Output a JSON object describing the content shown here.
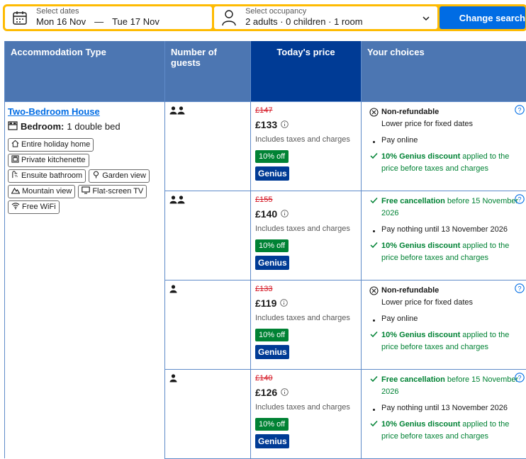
{
  "search": {
    "dates_label": "Select dates",
    "checkin": "Mon 16 Nov",
    "dash": "—",
    "checkout": "Tue 17 Nov",
    "occupancy_label": "Select occupancy",
    "occupancy_value": "2 adults · 0 children · 1 room",
    "button": "Change search"
  },
  "table": {
    "headers": [
      "Accommodation Type",
      "Number of guests",
      "Today's price",
      "Your choices"
    ]
  },
  "room": {
    "name": "Two-Bedroom House",
    "bedroom_label": "Bedroom:",
    "bedroom_value": "1 double bed",
    "amenities": [
      {
        "label": "Entire holiday home",
        "icon": "home-icon"
      },
      {
        "label": "Private kitchenette",
        "icon": "kitchen-icon"
      },
      {
        "label": "Ensuite bathroom",
        "icon": "shower-icon"
      },
      {
        "label": "Garden view",
        "icon": "tree-icon"
      },
      {
        "label": "Mountain view",
        "icon": "mountain-icon"
      },
      {
        "label": "Flat-screen TV",
        "icon": "tv-icon"
      },
      {
        "label": "Free WiFi",
        "icon": "wifi-icon"
      }
    ]
  },
  "rows": [
    {
      "guests": 2,
      "old_price": "£147",
      "price": "£133",
      "taxes": "Includes taxes and charges",
      "discount": "10% off",
      "genius": "Genius",
      "choices": {
        "first_title": "Non-refundable",
        "first_sub": "Lower price for fixed dates",
        "first_type": "nonrefund",
        "second": "Pay online",
        "genius_bold": "10% Genius discount",
        "genius_rest": " applied to the price before taxes and charges"
      }
    },
    {
      "guests": 2,
      "old_price": "£155",
      "price": "£140",
      "taxes": "Includes taxes and charges",
      "discount": "10% off",
      "genius": "Genius",
      "choices": {
        "first_title": "Free cancellation",
        "first_sub": " before 15 November 2026",
        "first_type": "free",
        "second": "Pay nothing until 13 November 2026",
        "genius_bold": "10% Genius discount",
        "genius_rest": " applied to the price before taxes and charges"
      }
    },
    {
      "guests": 1,
      "old_price": "£133",
      "price": "£119",
      "taxes": "Includes taxes and charges",
      "discount": "10% off",
      "genius": "Genius",
      "choices": {
        "first_title": "Non-refundable",
        "first_sub": "Lower price for fixed dates",
        "first_type": "nonrefund",
        "second": "Pay online",
        "genius_bold": "10% Genius discount",
        "genius_rest": " applied to the price before taxes and charges"
      }
    },
    {
      "guests": 1,
      "old_price": "£140",
      "price": "£126",
      "taxes": "Includes taxes and charges",
      "discount": "10% off",
      "genius": "Genius",
      "choices": {
        "first_title": "Free cancellation",
        "first_sub": " before 15 November 2026",
        "first_type": "free",
        "second": "Pay nothing until 13 November 2026",
        "genius_bold": "10% Genius discount",
        "genius_rest": " applied to the price before taxes and charges"
      }
    }
  ]
}
